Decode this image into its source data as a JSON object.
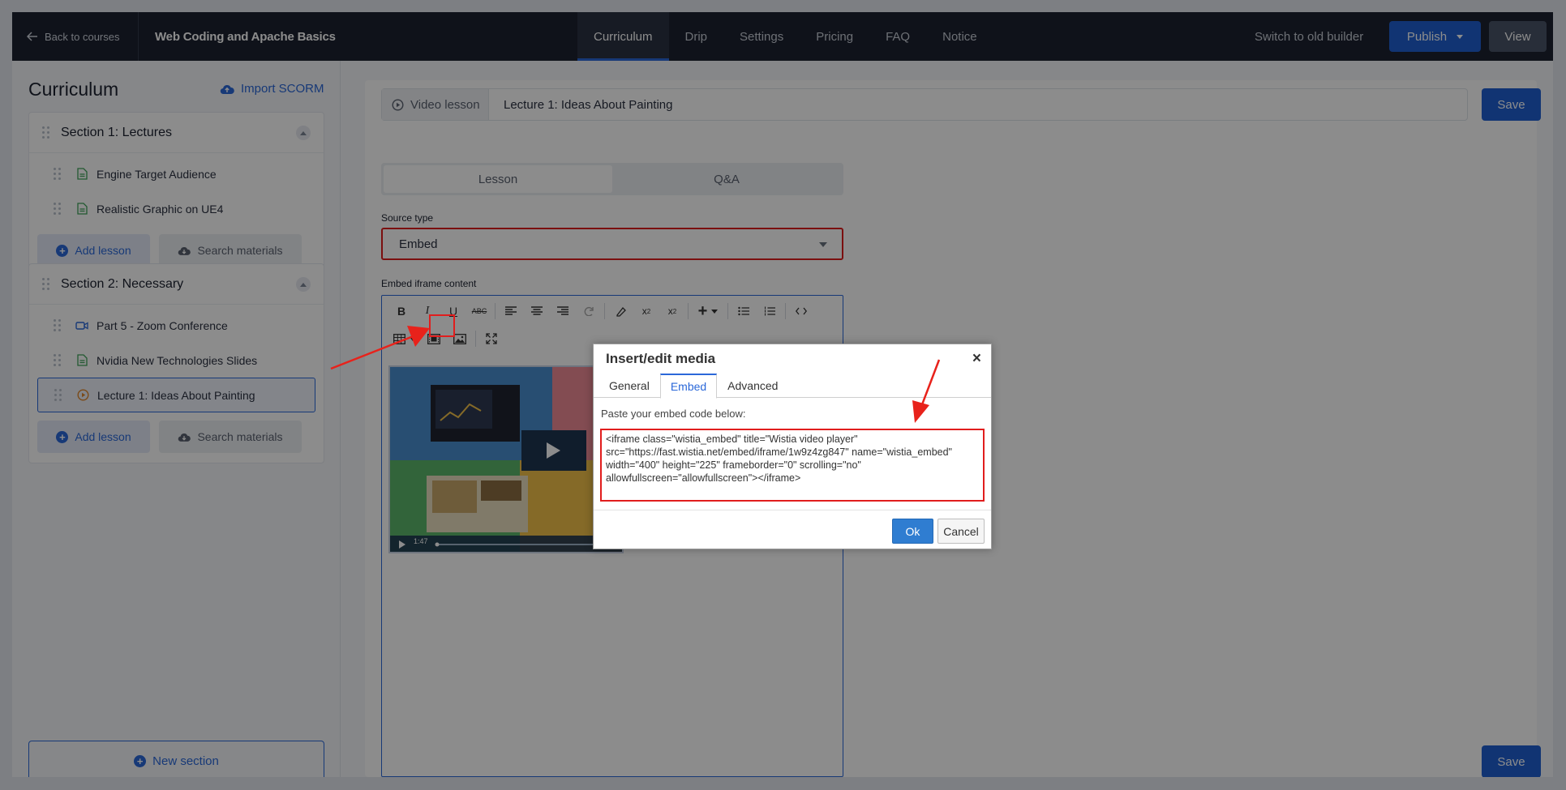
{
  "topbar": {
    "back_label": "Back to courses",
    "course_title": "Web Coding and Apache Basics",
    "tabs": [
      {
        "label": "Curriculum",
        "active": true
      },
      {
        "label": "Drip",
        "active": false
      },
      {
        "label": "Settings",
        "active": false
      },
      {
        "label": "Pricing",
        "active": false
      },
      {
        "label": "FAQ",
        "active": false
      },
      {
        "label": "Notice",
        "active": false
      }
    ],
    "switch_label": "Switch to old builder",
    "publish_label": "Publish",
    "view_label": "View"
  },
  "sidebar": {
    "title": "Curriculum",
    "import_label": "Import SCORM",
    "sections": [
      {
        "name": "Section 1: Lectures",
        "lessons": [
          {
            "title": "Engine Target Audience",
            "icon": "document-icon"
          },
          {
            "title": "Realistic Graphic on UE4",
            "icon": "document-icon"
          }
        ],
        "add_label": "Add lesson",
        "search_label": "Search materials"
      },
      {
        "name": "Section 2: Necessary",
        "lessons": [
          {
            "title": "Part 5 - Zoom Conference",
            "icon": "video-camera-icon"
          },
          {
            "title": "Nvidia New Technologies Slides",
            "icon": "document-icon"
          },
          {
            "title": "Lecture 1: Ideas About Painting",
            "icon": "play-circle-icon",
            "active": true
          }
        ],
        "add_label": "Add lesson",
        "search_label": "Search materials"
      }
    ],
    "new_section_label": "New section"
  },
  "main": {
    "lesson_type": "Video lesson",
    "lesson_name": "Lecture 1: Ideas About Painting",
    "save_label": "Save",
    "tabs": [
      {
        "label": "Lesson",
        "active": true
      },
      {
        "label": "Q&A",
        "active": false
      }
    ],
    "source_type_label": "Source type",
    "source_type_value": "Embed",
    "embed_label": "Embed iframe content",
    "video_time": "1:47"
  },
  "dialog": {
    "title": "Insert/edit media",
    "tabs": [
      {
        "label": "General",
        "active": false
      },
      {
        "label": "Embed",
        "active": true
      },
      {
        "label": "Advanced",
        "active": false
      }
    ],
    "hint": "Paste your embed code below:",
    "embed_code": "<iframe class=\"wistia_embed\" title=\"Wistia video player\" src=\"https://fast.wistia.net/embed/iframe/1w9z4zg847\" name=\"wistia_embed\" width=\"400\" height=\"225\" frameborder=\"0\" scrolling=\"no\" allowfullscreen=\"allowfullscreen\"></iframe>",
    "ok_label": "Ok",
    "cancel_label": "Cancel"
  },
  "colors": {
    "accent": "#1f5fd1",
    "topbar_bg": "#1c2230",
    "highlight_red": "#e11d1d",
    "lesson_doc_icon": "#3fa35a",
    "lesson_video_icon": "#2b68d9",
    "lesson_play_icon": "#e0882c"
  }
}
